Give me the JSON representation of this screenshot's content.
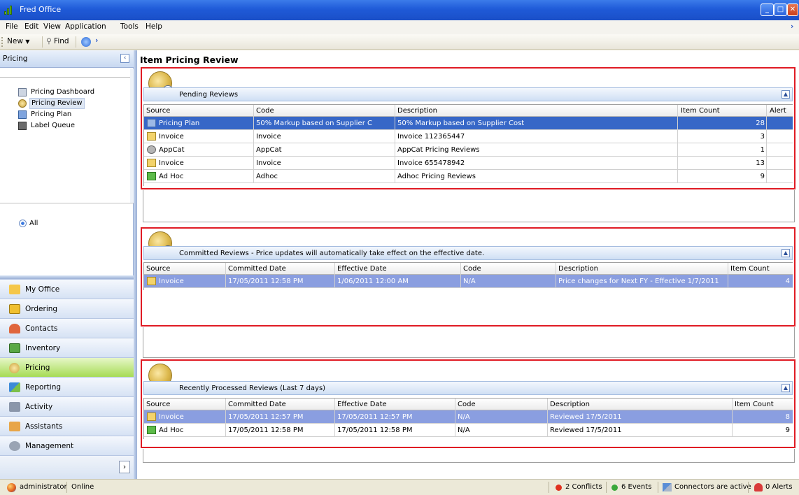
{
  "window": {
    "title": "Fred Office"
  },
  "menu": {
    "file": "File",
    "edit": "Edit",
    "view": "View",
    "application": "Application",
    "tools": "Tools",
    "help": "Help"
  },
  "toolbar": {
    "new": "New",
    "find": "Find"
  },
  "left": {
    "header": "Pricing",
    "tree": [
      "Pricing Dashboard",
      "Pricing Review",
      "Pricing Plan",
      "Label Queue"
    ],
    "filter": "All",
    "nav": [
      "My Office",
      "Ordering",
      "Contacts",
      "Inventory",
      "Pricing",
      "Reporting",
      "Activity",
      "Assistants",
      "Management"
    ]
  },
  "page": {
    "title": "Item Pricing Review"
  },
  "pending": {
    "title": "Pending Reviews",
    "columns": [
      "Source",
      "Code",
      "Description",
      "Item Count",
      "Alert"
    ],
    "rows": [
      {
        "source": "Pricing Plan",
        "code": "50% Markup based on Supplier C",
        "description": "50% Markup based on Supplier Cost",
        "count": "28"
      },
      {
        "source": "Invoice",
        "code": "Invoice",
        "description": "Invoice 112365447",
        "count": "3"
      },
      {
        "source": "AppCat",
        "code": "AppCat",
        "description": "AppCat Pricing Reviews",
        "count": "1"
      },
      {
        "source": "Invoice",
        "code": "Invoice",
        "description": "Invoice 655478942",
        "count": "13"
      },
      {
        "source": "Ad Hoc",
        "code": "Adhoc",
        "description": "Adhoc Pricing Reviews",
        "count": "9"
      }
    ]
  },
  "committed": {
    "title": "Committed Reviews -  Price updates will automatically take effect on the effective date.",
    "columns": [
      "Source",
      "Committed Date",
      "Effective Date",
      "Code",
      "Description",
      "Item Count"
    ],
    "rows": [
      {
        "source": "Invoice",
        "committed": "17/05/2011 12:58 PM",
        "effective": "1/06/2011 12:00 AM",
        "code": "N/A",
        "description": "Price changes for Next FY - Effective 1/7/2011",
        "count": "4"
      }
    ]
  },
  "processed": {
    "title": "Recently Processed Reviews (Last 7 days)",
    "columns": [
      "Source",
      "Committed Date",
      "Effective Date",
      "Code",
      "Description",
      "Item Count"
    ],
    "rows": [
      {
        "source": "Invoice",
        "committed": "17/05/2011 12:57 PM",
        "effective": "17/05/2011 12:57 PM",
        "code": "N/A",
        "description": "Reviewed 17/5/2011",
        "count": "8"
      },
      {
        "source": "Ad Hoc",
        "committed": "17/05/2011 12:58 PM",
        "effective": "17/05/2011 12:58 PM",
        "code": "N/A",
        "description": "Reviewed 17/5/2011",
        "count": "9"
      }
    ]
  },
  "status": {
    "user": "administrator",
    "state": "Online",
    "conflicts": "2 Conflicts",
    "events": "6 Events",
    "connectors": "Connectors are active",
    "alerts": "0 Alerts"
  },
  "colors": {
    "title_bar": "#1f5ad8",
    "selected_row": "#3767c7",
    "committed_row": "#8a9ee0",
    "highlight_box": "#e01b24",
    "active_nav": "#a6dc55"
  }
}
